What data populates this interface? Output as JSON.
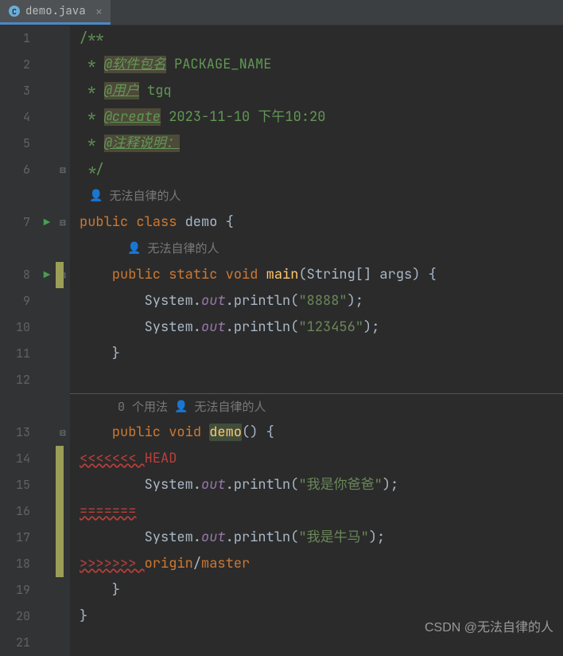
{
  "tab": {
    "filename": "demo.java",
    "close": "×"
  },
  "gutter": {
    "lines": [
      "1",
      "2",
      "3",
      "4",
      "5",
      "6",
      "7",
      "8",
      "9",
      "10",
      "11",
      "12",
      "13",
      "14",
      "15",
      "16",
      "17",
      "18",
      "19",
      "20",
      "21"
    ]
  },
  "hints": {
    "author": "无法自律的人",
    "usages": "0 个用法"
  },
  "code": {
    "l1": "/**",
    "l2_star": " * ",
    "l2_tag": "@软件包名",
    "l2_val": " PACKAGE_NAME",
    "l3_tag": "@用户",
    "l3_val": " tgq",
    "l4_tag": "@create",
    "l4_val": " 2023-11-10 下午10:20",
    "l5_tag": "@注释说明：",
    "l6": " */",
    "l7_public": "public ",
    "l7_class": "class ",
    "l7_name": "demo ",
    "l7_brace": "{",
    "l8_indent": "    ",
    "l8_public": "public ",
    "l8_static": "static ",
    "l8_void": "void ",
    "l8_main": "main",
    "l8_params": "(String[] args) {",
    "l9_indent": "        ",
    "l9_sys": "System.",
    "l9_out": "out",
    "l9_print": ".println(",
    "l9_str": "\"8888\"",
    "l9_end": ");",
    "l10_str": "\"123456\"",
    "l11": "    }",
    "l13_public": "public ",
    "l13_void": "void ",
    "l13_name": "demo",
    "l13_params": "() {",
    "l14": "<<<<<<< ",
    "l14_head": "HEAD",
    "l15_str": "\"我是你爸爸\"",
    "l16": "=======",
    "l17_str": "\"我是牛马\"",
    "l18": ">>>>>>> ",
    "l18_origin": "origin",
    "l18_slash": "/",
    "l18_master": "master",
    "l19": "    }",
    "l20": "}"
  },
  "watermark": "CSDN @无法自律的人"
}
